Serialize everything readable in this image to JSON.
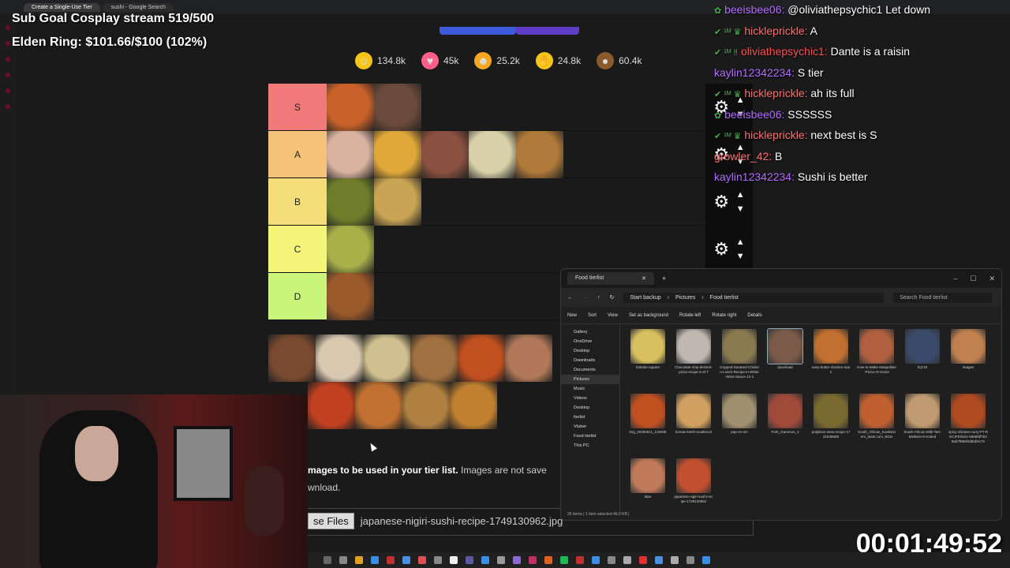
{
  "browser": {
    "tabs": [
      "Create a Single-Use Tier",
      "sushi - Google Search"
    ]
  },
  "overlay": {
    "sub_goal": "Sub Goal Cosplay stream 519/500",
    "elden": "Elden Ring: $101.66/$100 (102%)",
    "timer": "00:01:49:52"
  },
  "reactions": [
    {
      "icon": "grinning-face-icon",
      "count": "134.8k",
      "color": "#f5c518"
    },
    {
      "icon": "heart-eyes-icon",
      "count": "45k",
      "color": "#ff5f8a"
    },
    {
      "icon": "laughing-face-icon",
      "count": "25.2k",
      "color": "#f5a623"
    },
    {
      "icon": "raised-hands-icon",
      "count": "24.8k",
      "color": "#f5c518"
    },
    {
      "icon": "poop-icon",
      "count": "60.4k",
      "color": "#8b5a2b"
    }
  ],
  "tiers": [
    {
      "label": "S",
      "color": "#f07a7a",
      "items": [
        "#c9622a",
        "#6a4a3a"
      ]
    },
    {
      "label": "A",
      "color": "#f5c27a",
      "items": [
        "#d9b3a0",
        "#e0a73a",
        "#8a5040",
        "#d8d0a8",
        "#b07a3a"
      ]
    },
    {
      "label": "B",
      "color": "#f5de7a",
      "items": [
        "#6f7d2a",
        "#c9a454"
      ]
    },
    {
      "label": "C",
      "color": "#f5f57a",
      "items": [
        "#a8b04a"
      ]
    },
    {
      "label": "D",
      "color": "#c8f57a",
      "items": [
        "#9a5a2a"
      ]
    }
  ],
  "pool": [
    "#7a4a30",
    "#d8c8b0",
    "#d0c090",
    "#a07040",
    "#c05020",
    "#b07858",
    "#c04020",
    "#c07030",
    "#b08040",
    "#c08030"
  ],
  "info": {
    "bold": "mages to be used in your tier list.",
    "rest": " Images are not save",
    "line2": "wnload.",
    "file_button": "se Files",
    "file_name": "japanese-nigiri-sushi-recipe-1749130962.jpg"
  },
  "chat": [
    {
      "user": "beeisbee06:",
      "color": "#b46bff",
      "msg": "@oliviathepsychic1 Let down",
      "badges": "✿"
    },
    {
      "user": "hickleprickle:",
      "color": "#ff6f6f",
      "msg": "A",
      "badges": "✔ ¹ᴹ ♛"
    },
    {
      "user": "oliviathepsychic1:",
      "color": "#ff4d4d",
      "msg": "Dante is a raisin",
      "badges": "✔ ¹ᴹ ‼"
    },
    {
      "user": "kaylin12342234:",
      "color": "#b46bff",
      "msg": "S tier",
      "badges": ""
    },
    {
      "user": "hickleprickle:",
      "color": "#ff6f6f",
      "msg": "ah its full",
      "badges": "✔ ¹ᴹ ♛"
    },
    {
      "user": "beeisbee06:",
      "color": "#b46bff",
      "msg": "SSSSSS",
      "badges": "✿"
    },
    {
      "user": "hickleprickle:",
      "color": "#ff6f6f",
      "msg": "next best is S",
      "badges": "✔ ¹ᴹ ♛"
    },
    {
      "user": "growler_42:",
      "color": "#ff6f6f",
      "msg": "B",
      "badges": ""
    },
    {
      "user": "kaylin12342234:",
      "color": "#b46bff",
      "msg": "Sushi is better",
      "badges": ""
    }
  ],
  "explorer": {
    "tab_title": "Food tierlist",
    "crumbs": [
      "Start backup",
      "Pictures",
      "Food tierlist"
    ],
    "search_placeholder": "Search Food tierlist",
    "toolbar": [
      "New",
      "Sort",
      "View",
      "Set as background",
      "Rotate left",
      "Rotate right",
      "Details"
    ],
    "nav": [
      "Gallery",
      "OneDrive",
      "Desktop",
      "Downloads",
      "Documents",
      "Pictures",
      "Music",
      "Videos",
      "Desktop",
      "tierlist",
      "Vtuber",
      "Food tierlist",
      "This PC"
    ],
    "files": [
      {
        "name": "bobotie-square",
        "color": "#d8c060"
      },
      {
        "name": "Chocolate-chip-dessert-pizza-recipe-3-of-7",
        "color": "#c0b8b0"
      },
      {
        "name": "cropped-Sauteed-Chicken-Livers-Recipe-in-White-Wine-Sauce-12-1",
        "color": "#8a7a50"
      },
      {
        "name": "download",
        "color": "#7a5a48"
      },
      {
        "name": "easy-butter-chicken-naan",
        "color": "#c07030"
      },
      {
        "name": "How-to-Make-Neapolitan-Pizza-At-Home",
        "color": "#b06040"
      },
      {
        "name": "hq720",
        "color": "#3a4a6a"
      },
      {
        "name": "images",
        "color": "#c08050"
      },
      {
        "name": "img_20200511_133008",
        "color": "#c05020"
      },
      {
        "name": "korean-beef-noodles13",
        "color": "#d0a060"
      },
      {
        "name": "pap-en-sm",
        "color": "#a09070"
      },
      {
        "name": "Pork_Gammon_2",
        "color": "#a04a3a"
      },
      {
        "name": "potjiekos-stew-recipe-1721849669",
        "color": "#7a6a30"
      },
      {
        "name": "South_African_Koeksisters_taste.com_843x",
        "color": "#c06030"
      },
      {
        "name": "South-African-Milk-Tart-Melktert-9-scaled",
        "color": "#c09a70"
      },
      {
        "name": "spicy-chicken-curry-FT-RECIPE0621-5686fdf7b48ab7f868f4d8ab0c7e",
        "color": "#b04a20"
      },
      {
        "name": "tripe",
        "color": "#c07a5a"
      },
      {
        "name": "japanese-nigiri-sushi-recipe-1749130962",
        "color": "#c05030"
      }
    ],
    "status": "26 items  |  1 item selected  46.0 KB  |"
  }
}
